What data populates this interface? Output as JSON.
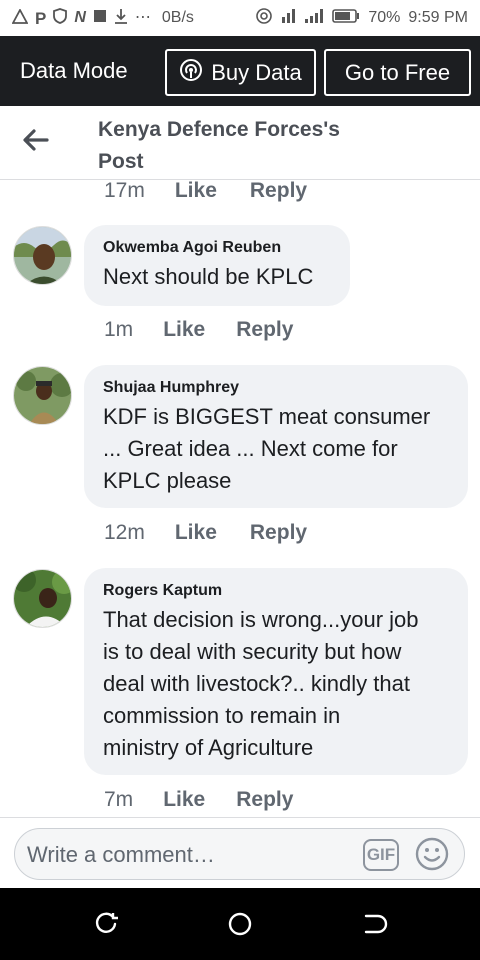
{
  "status_bar": {
    "speed": "0B/s",
    "battery": "70%",
    "time": "9:59 PM"
  },
  "data_bar": {
    "label": "Data Mode",
    "buy_label": "Buy Data",
    "free_label": "Go to Free"
  },
  "header": {
    "title": "Kenya Defence Forces's Post"
  },
  "comments": {
    "first_meta": {
      "time": "17m",
      "like": "Like",
      "reply": "Reply"
    },
    "items": [
      {
        "author": "Okwemba Agoi Reuben",
        "text": "Next should be KPLC",
        "time": "1m",
        "like": "Like",
        "reply": "Reply"
      },
      {
        "author": "Shujaa Humphrey",
        "lines": [
          "KDF is BIGGEST meat consumer",
          "... Great idea ... Next come for",
          "KPLC please"
        ],
        "time": "12m",
        "like": "Like",
        "reply": "Reply"
      },
      {
        "author": "Rogers Kaptum",
        "lines": [
          "That decision is wrong...your job",
          "is to deal with security but how",
          "deal with livestock?.. kindly that",
          "commission to remain in",
          "ministry of Agriculture"
        ],
        "time": "7m",
        "like": "Like",
        "reply": "Reply"
      }
    ]
  },
  "composer": {
    "placeholder": "Write a comment…",
    "gif_label": "GIF"
  },
  "colors": {
    "data_bar_bg": "#1c1e21",
    "bubble_bg": "#f0f2f5",
    "meta_text": "#606770"
  }
}
